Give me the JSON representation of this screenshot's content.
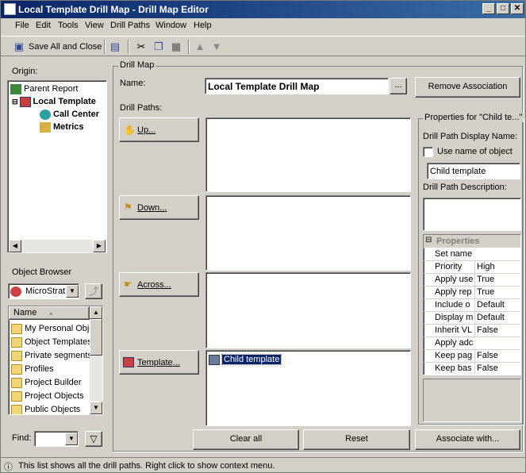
{
  "window": {
    "title": "Local Template Drill Map - Drill Map Editor"
  },
  "menu": [
    "File",
    "Edit",
    "Tools",
    "View",
    "Drill Paths",
    "Window",
    "Help"
  ],
  "toolbar": {
    "save_all_label": "Save All and Close"
  },
  "origin": {
    "label": "Origin:",
    "items": [
      "Parent Report",
      "Local Template",
      "Call Center",
      "Metrics"
    ]
  },
  "object_browser": {
    "label": "Object Browser",
    "source": "MicroStrat",
    "column_name": "Name",
    "items": [
      "My Personal Obje",
      "Object Templates",
      "Private segments",
      "Profiles",
      "Project Builder",
      "Project Objects",
      "Public Objects"
    ],
    "find_label": "Find:"
  },
  "drill_map": {
    "group_label": "Drill Map",
    "name_label": "Name:",
    "name_value": "Local Template Drill Map",
    "browse_label": "...",
    "remove_label": "Remove Association",
    "paths_label": "Drill Paths:",
    "up_label": "Up...",
    "down_label": "Down...",
    "across_label": "Across...",
    "template_label": "Template...",
    "template_item": "Child template",
    "clear_label": "Clear all",
    "reset_label": "Reset",
    "associate_label": "Associate with..."
  },
  "properties": {
    "group_label": "Properties for \"Child te...\"",
    "display_name_label": "Drill Path Display Name:",
    "use_name_label": "Use name of object",
    "display_name_value": "Child template",
    "description_label": "Drill Path Description:",
    "grid_header": "Properties",
    "rows": [
      {
        "k": "Set name",
        "v": ""
      },
      {
        "k": "Priority",
        "v": "High"
      },
      {
        "k": "Apply use",
        "v": "True"
      },
      {
        "k": "Apply rep",
        "v": "True"
      },
      {
        "k": "Include o",
        "v": "Default"
      },
      {
        "k": "Display m",
        "v": "Default"
      },
      {
        "k": "Inherit VL",
        "v": "False"
      },
      {
        "k": "Apply adc",
        "v": ""
      },
      {
        "k": "Keep pag",
        "v": "False"
      },
      {
        "k": "Keep bas",
        "v": "False"
      }
    ]
  },
  "status": {
    "text": "This list shows all the drill paths. Right click to show context menu."
  }
}
